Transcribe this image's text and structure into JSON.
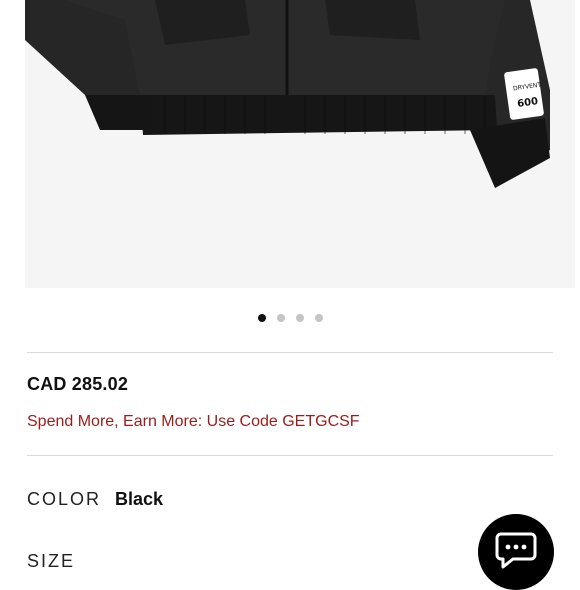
{
  "product": {
    "price": "CAD 285.02",
    "promo": "Spend More, Earn More: Use Code GETGCSF",
    "sleeve_patch_text": "600",
    "sleeve_patch_small": "DRYVENT"
  },
  "carousel": {
    "total": 4,
    "active_index": 0
  },
  "options": {
    "color_label": "COLOR",
    "color_value": "Black",
    "size_label": "SIZE"
  },
  "chat": {
    "icon": "chat-bubble-icon"
  },
  "colors": {
    "jacket": "#2b2b2b",
    "promo_red": "#9b1c1c",
    "background": "#ffffff"
  }
}
